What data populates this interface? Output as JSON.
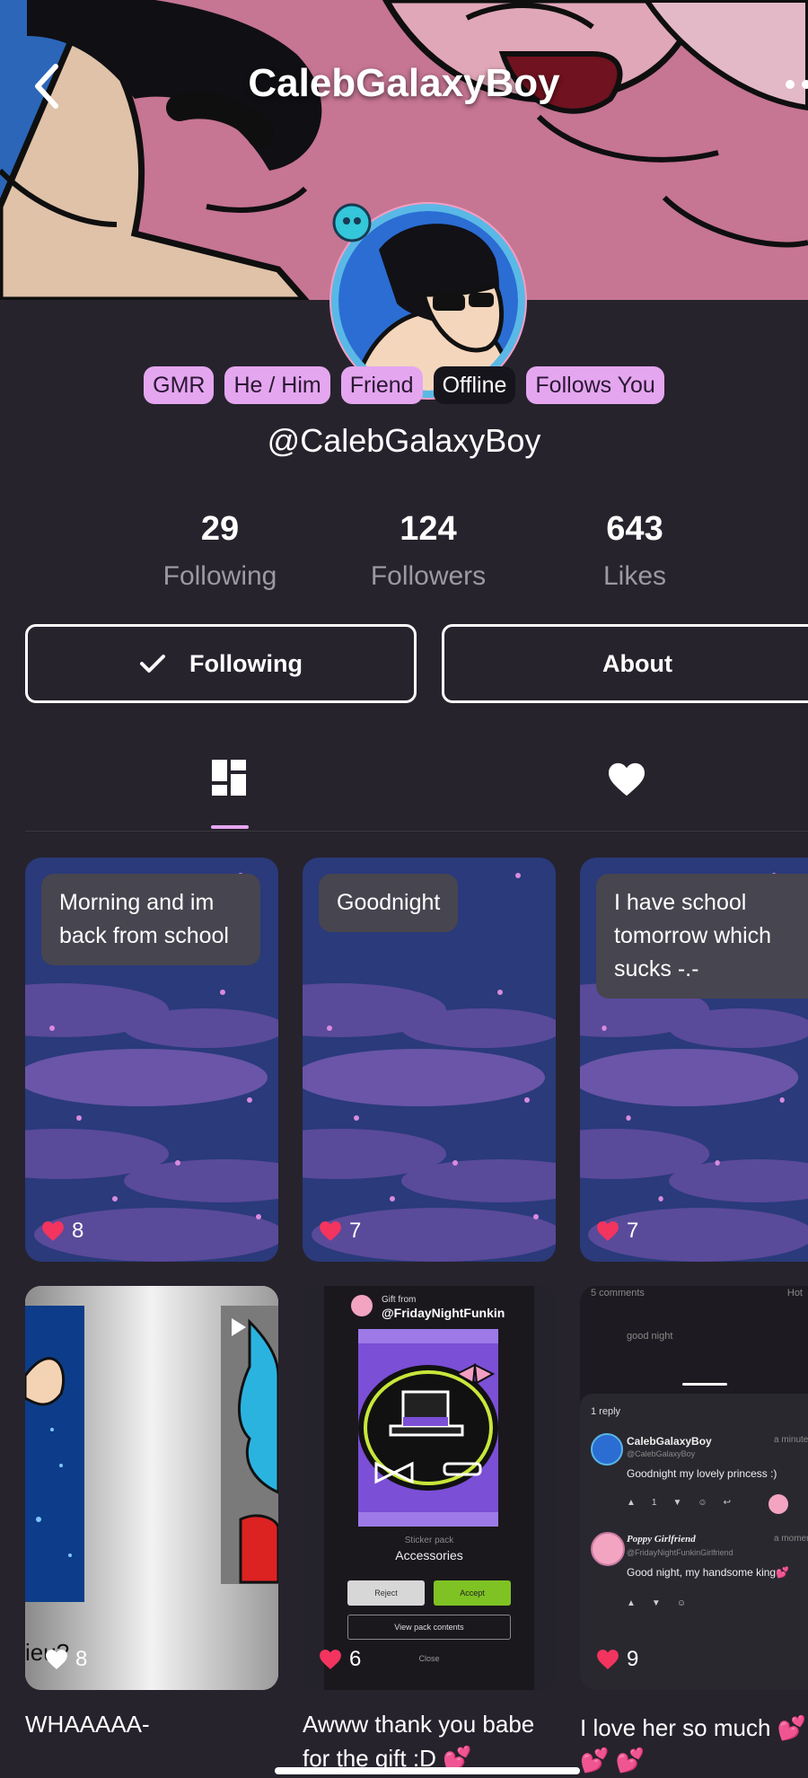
{
  "header": {
    "title": "CalebGalaxyBoy"
  },
  "profile": {
    "badges": [
      {
        "label": "GMR",
        "variant": "pink"
      },
      {
        "label": "He / Him",
        "variant": "pink"
      },
      {
        "label": "Friend",
        "variant": "pink"
      },
      {
        "label": "Offline",
        "variant": "dark"
      },
      {
        "label": "Follows You",
        "variant": "pink"
      }
    ],
    "handle": "@CalebGalaxyBoy"
  },
  "stats": {
    "following": {
      "value": "29",
      "label": "Following"
    },
    "followers": {
      "value": "124",
      "label": "Followers"
    },
    "likes": {
      "value": "643",
      "label": "Likes"
    }
  },
  "actions": {
    "following_label": "Following",
    "about_label": "About"
  },
  "tabs": {
    "grid_icon": "grid-icon",
    "liked_icon": "heart-icon",
    "active": "grid"
  },
  "posts": [
    {
      "text": "Morning and im back from school",
      "likes": "8"
    },
    {
      "text": "Goodnight",
      "likes": "7"
    },
    {
      "text": "I have school tomorrow which sucks -.-",
      "likes": "7"
    },
    {
      "overlay_text": "ieu?",
      "likes": "8",
      "caption": "WHAAAAA-"
    },
    {
      "likes": "6",
      "caption_line1": "Awww thank you babe",
      "caption_line2": "for the gift :D 💕",
      "gift": {
        "from_label": "Gift from",
        "from_user": "@FridayNightFunkin",
        "type": "Sticker pack",
        "name": "Accessories",
        "reject": "Reject",
        "accept": "Accept",
        "view": "View pack contents",
        "close": "Close"
      }
    },
    {
      "likes": "9",
      "caption_line1": "I love her so much 💕",
      "caption_line2": "💕 💕",
      "thread": {
        "comments_count": "5 comments",
        "sort": "Hot",
        "prev_reply": "good night",
        "reply_count": "1 reply",
        "c1_user": "CalebGalaxyBoy",
        "c1_handle": "@CalebGalaxyBoy",
        "c1_time": "a minute",
        "c1_text": "Goodnight my lovely princess :)",
        "c1_likes": "1",
        "c2_user": "Poppy Girlfriend",
        "c2_handle": "@FridayNightFunkinGirlfriend",
        "c2_time": "a moment",
        "c2_text": "Good night, my handsome king💕"
      }
    }
  ],
  "colors": {
    "accent": "#e5a6f0",
    "background": "#26232d",
    "like": "#f2345f"
  }
}
